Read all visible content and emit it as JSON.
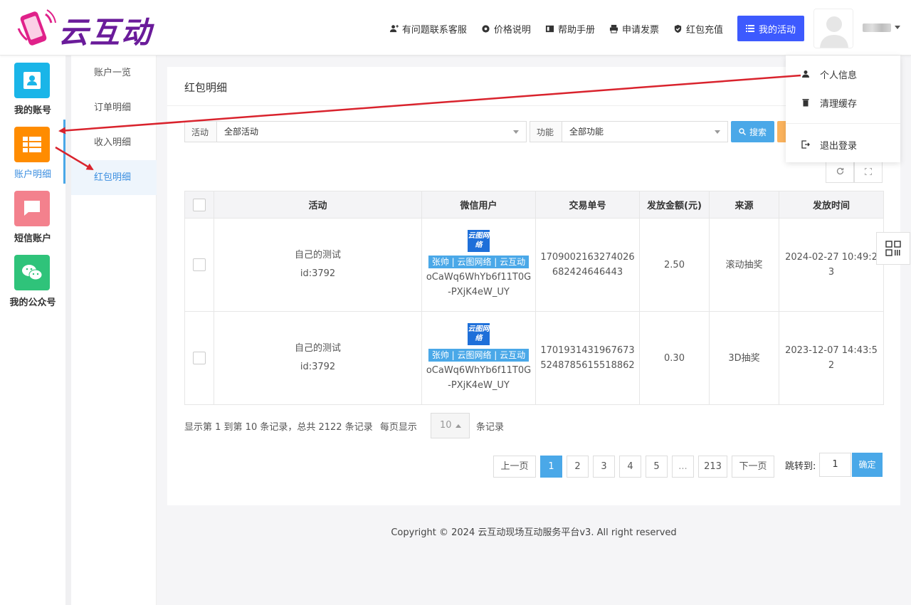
{
  "app": {
    "logo_text": "云互动"
  },
  "header": {
    "nav": [
      {
        "label": "有问题联系客服",
        "icon": "user-plus-icon"
      },
      {
        "label": "价格说明",
        "icon": "gear-icon"
      },
      {
        "label": "帮助手册",
        "icon": "book-icon"
      },
      {
        "label": "申请发票",
        "icon": "printer-icon"
      },
      {
        "label": "红包充值",
        "icon": "shield-check-icon"
      }
    ],
    "activity_button": "我的活动"
  },
  "icon_sidebar": {
    "items": [
      {
        "label": "我的账号",
        "color": "#1ab5e8",
        "icon": "contact-card-icon"
      },
      {
        "label": "账户明细",
        "color": "#ff8c00",
        "icon": "table-list-icon"
      },
      {
        "label": "短信账户",
        "color": "#f3818d",
        "icon": "chat-bubble-icon"
      },
      {
        "label": "我的公众号",
        "color": "#2fc37a",
        "icon": "wechat-icon"
      }
    ]
  },
  "sub_nav": {
    "items": [
      "账户一览",
      "订单明细",
      "收入明细",
      "红包明细"
    ]
  },
  "card": {
    "title": "红包明细"
  },
  "filters": {
    "activity_label": "活动",
    "activity_value": "全部活动",
    "function_label": "功能",
    "function_value": "全部功能",
    "search_button": "搜索"
  },
  "table": {
    "headers": [
      "活动",
      "微信用户",
      "交易单号",
      "发放金额(元)",
      "来源",
      "发放时间"
    ],
    "rows": [
      {
        "activity_name": "自己的测试",
        "activity_id": "id:3792",
        "wx_logo": "云图网络",
        "wx_tag": "张帅 | 云图网络 | 云互动",
        "wx_openid": "oCaWq6WhYb6f11T0G-PXjK4eW_UY",
        "txn": "1709002163274026682424646443",
        "amount": "2.50",
        "source": "滚动抽奖",
        "time": "2024-02-27 10:49:23"
      },
      {
        "activity_name": "自己的测试",
        "activity_id": "id:3792",
        "wx_logo": "云图网络",
        "wx_tag": "张帅 | 云图网络 | 云互动",
        "wx_openid": "oCaWq6WhYb6f11T0G-PXjK4eW_UY",
        "txn": "17019314319676735248785615518862",
        "amount": "0.30",
        "source": "3D抽奖",
        "time": "2023-12-07 14:43:52"
      }
    ]
  },
  "pagination": {
    "info": "显示第 1 到第 10 条记录，总共 2122 条记录",
    "per_page_label": "每页显示",
    "per_page_value": "10",
    "per_page_suffix": "条记录",
    "prev": "上一页",
    "next": "下一页",
    "pages": [
      "1",
      "2",
      "3",
      "4",
      "5",
      "...",
      "213"
    ],
    "current": "1",
    "jump_label": "跳转到:",
    "jump_value": "1",
    "jump_button": "确定"
  },
  "dropdown": {
    "items": [
      {
        "label": "个人信息",
        "icon": "user-icon"
      },
      {
        "label": "清理缓存",
        "icon": "trash-icon"
      },
      {
        "label": "退出登录",
        "icon": "logout-icon"
      }
    ]
  },
  "footer": {
    "text": "Copyright © 2024 云互动现场互动服务平台v3. All right reserved"
  },
  "colors": {
    "accent": "#3d5afe",
    "primary_blue": "#4aa8e8",
    "annotation_red": "#d9232d"
  }
}
